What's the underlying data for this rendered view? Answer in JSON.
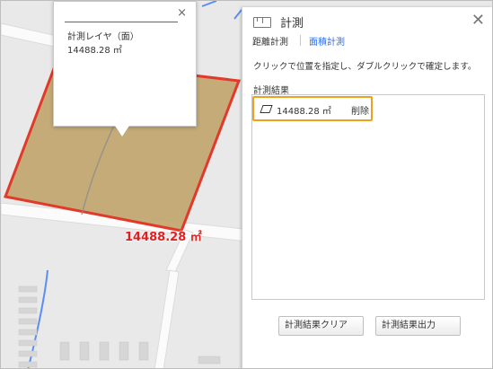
{
  "popup": {
    "title": "計測レイヤ（面）",
    "value": "14488.28 ㎡",
    "close_icon": "×"
  },
  "map": {
    "area_label": "14488.28 ㎡",
    "polygon_fill": "#c1a56e",
    "polygon_stroke": "#e23a2a",
    "road_color": "#fafafa",
    "bg_color": "#e9e9e9",
    "canal_color": "#5b8ef5"
  },
  "panel": {
    "icon": "ruler-icon",
    "title": "計測",
    "close_icon": "✕",
    "tabs": [
      {
        "label": "距離計測"
      },
      {
        "label": "面積計測"
      }
    ],
    "instruction": "クリックで位置を指定し、ダブルクリックで確定します。",
    "results_label": "計測結果",
    "result": {
      "icon": "polygon-icon",
      "value": "14488.28 ㎡",
      "delete_label": "削除"
    },
    "buttons": {
      "clear": "計測結果クリア",
      "export": "計測結果出力"
    }
  }
}
